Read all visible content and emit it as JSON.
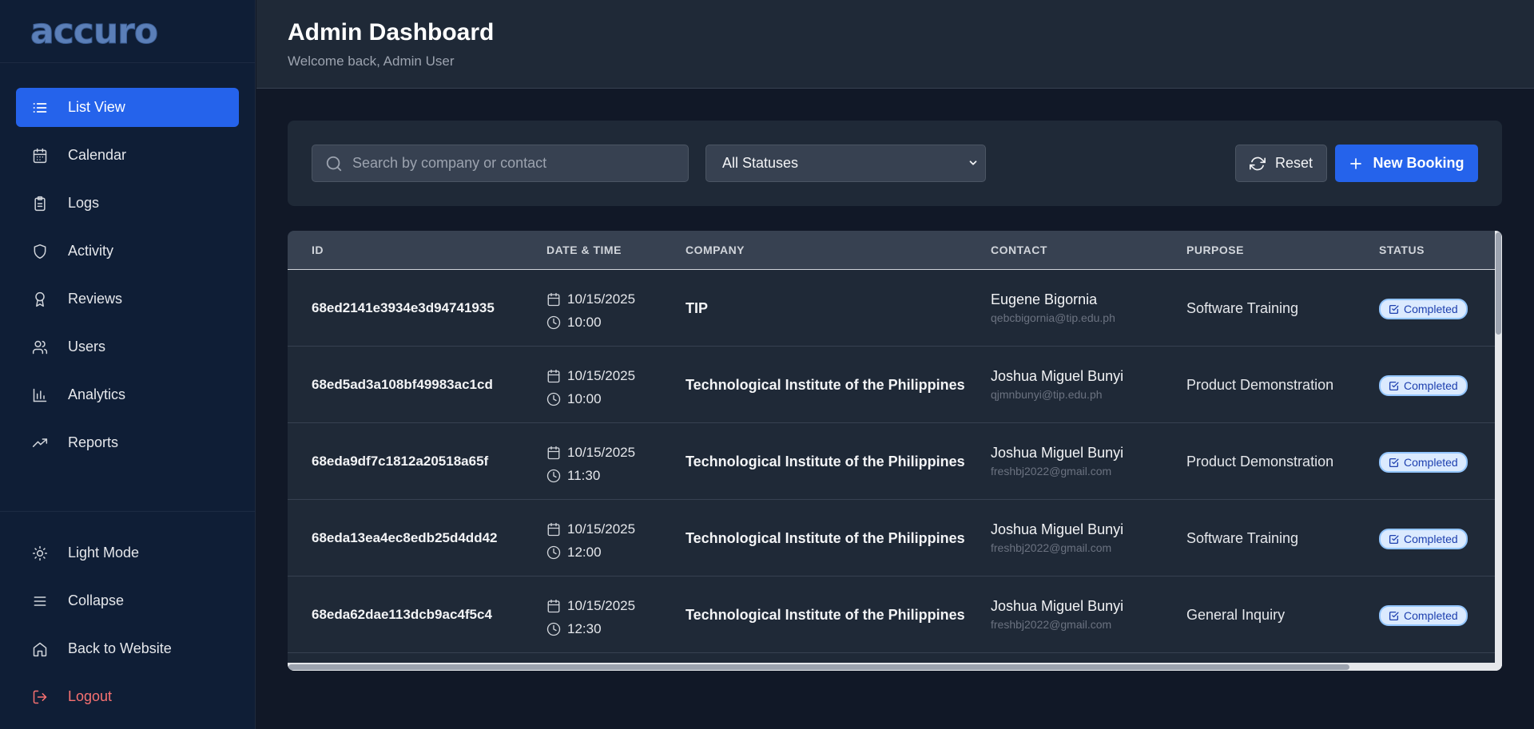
{
  "app": {
    "logo": "accuro"
  },
  "sidebar": {
    "items": [
      {
        "label": "List View",
        "icon": "list-icon",
        "active": true
      },
      {
        "label": "Calendar",
        "icon": "calendar-icon"
      },
      {
        "label": "Logs",
        "icon": "clipboard-icon"
      },
      {
        "label": "Activity",
        "icon": "shield-icon"
      },
      {
        "label": "Reviews",
        "icon": "award-icon"
      },
      {
        "label": "Users",
        "icon": "users-icon"
      },
      {
        "label": "Analytics",
        "icon": "bar-chart-icon"
      },
      {
        "label": "Reports",
        "icon": "trending-up-icon"
      }
    ],
    "bottom": [
      {
        "label": "Light Mode",
        "icon": "sun-icon"
      },
      {
        "label": "Collapse",
        "icon": "menu-icon"
      },
      {
        "label": "Back to Website",
        "icon": "home-icon"
      },
      {
        "label": "Logout",
        "icon": "logout-icon"
      }
    ]
  },
  "header": {
    "title": "Admin Dashboard",
    "subtitle": "Welcome back, Admin User"
  },
  "filters": {
    "search_placeholder": "Search by company or contact",
    "status_selected": "All Statuses",
    "reset_label": "Reset",
    "new_label": "New Booking"
  },
  "table": {
    "columns": [
      "ID",
      "DATE & TIME",
      "COMPANY",
      "CONTACT",
      "PURPOSE",
      "STATUS"
    ],
    "rows": [
      {
        "id": "68ed2141e3934e3d94741935",
        "date": "10/15/2025",
        "time": "10:00",
        "company": "TIP",
        "contact_name": "Eugene Bigornia",
        "contact_email": "qebcbigornia@tip.edu.ph",
        "purpose": "Software Training",
        "status": "Completed"
      },
      {
        "id": "68ed5ad3a108bf49983ac1cd",
        "date": "10/15/2025",
        "time": "10:00",
        "company": "Technological Institute of the Philippines",
        "contact_name": "Joshua Miguel Bunyi",
        "contact_email": "qjmnbunyi@tip.edu.ph",
        "purpose": "Product Demonstration",
        "status": "Completed"
      },
      {
        "id": "68eda9df7c1812a20518a65f",
        "date": "10/15/2025",
        "time": "11:30",
        "company": "Technological Institute of the Philippines",
        "contact_name": "Joshua Miguel Bunyi",
        "contact_email": "freshbj2022@gmail.com",
        "purpose": "Product Demonstration",
        "status": "Completed"
      },
      {
        "id": "68eda13ea4ec8edb25d4dd42",
        "date": "10/15/2025",
        "time": "12:00",
        "company": "Technological Institute of the Philippines",
        "contact_name": "Joshua Miguel Bunyi",
        "contact_email": "freshbj2022@gmail.com",
        "purpose": "Software Training",
        "status": "Completed"
      },
      {
        "id": "68eda62dae113dcb9ac4f5c4",
        "date": "10/15/2025",
        "time": "12:30",
        "company": "Technological Institute of the Philippines",
        "contact_name": "Joshua Miguel Bunyi",
        "contact_email": "freshbj2022@gmail.com",
        "purpose": "General Inquiry",
        "status": "Completed"
      }
    ]
  },
  "colors": {
    "accent": "#2563eb",
    "sidebar_bg": "#0f1e36",
    "panel_bg": "#1f2937",
    "badge_bg": "#dbeafe",
    "logout": "#f87171"
  }
}
